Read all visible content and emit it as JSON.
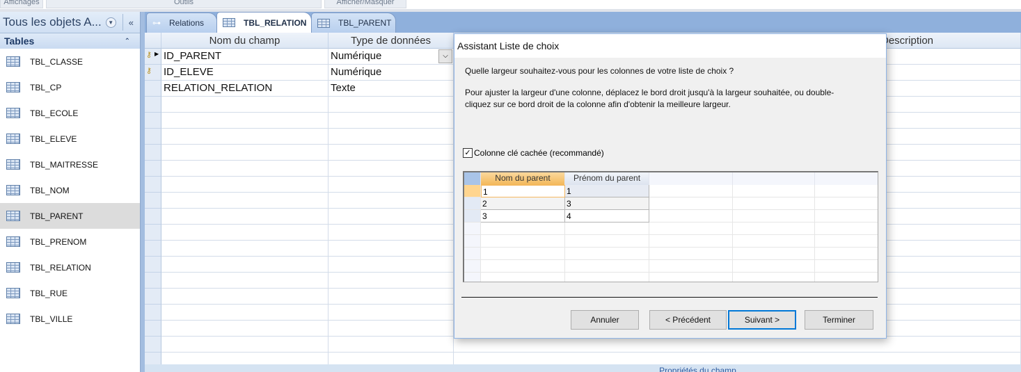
{
  "ribbon": {
    "groups": [
      "Affichages",
      "Outils",
      "Afficher/Masquer"
    ]
  },
  "nav": {
    "title": "Tous les objets A...",
    "section": "Tables",
    "items": [
      "TBL_CLASSE",
      "TBL_CP",
      "TBL_ECOLE",
      "TBL_ELEVE",
      "TBL_MAITRESSE",
      "TBL_NOM",
      "TBL_PARENT",
      "TBL_PRENOM",
      "TBL_RELATION",
      "TBL_RUE",
      "TBL_VILLE"
    ],
    "selected": "TBL_PARENT"
  },
  "tabs": [
    {
      "label": "Relations"
    },
    {
      "label": "TBL_RELATION",
      "active": true
    },
    {
      "label": "TBL_PARENT"
    }
  ],
  "grid": {
    "headers": [
      "Nom du champ",
      "Type de données",
      "Description"
    ],
    "rows": [
      {
        "name": "ID_PARENT",
        "type": "Numérique",
        "key": true,
        "current": true
      },
      {
        "name": "ID_ELEVE",
        "type": "Numérique",
        "key": true
      },
      {
        "name": "RELATION_RELATION",
        "type": "Texte"
      }
    ]
  },
  "bottom": {
    "label": "Propriétés du champ"
  },
  "dialog": {
    "title": "Assistant Liste de choix",
    "question": "Quelle largeur souhaitez-vous pour les colonnes de votre liste de choix ?",
    "instructions_1": "Pour ajuster la largeur d'une colonne, déplacez le bord droit jusqu'à la largeur souhaitée, ou double-",
    "instructions_2": "cliquez sur ce bord droit de la colonne afin d'obtenir la meilleure largeur.",
    "checkbox_label": "Colonne clé cachée (recommandé)",
    "checkbox_checked": true,
    "preview": {
      "headers": [
        "Nom du parent",
        "Prénom du parent"
      ],
      "rows": [
        [
          "1",
          "1"
        ],
        [
          "2",
          "3"
        ],
        [
          "3",
          "4"
        ]
      ]
    },
    "buttons": {
      "cancel": "Annuler",
      "previous": "< Précédent",
      "next": "Suivant >",
      "finish": "Terminer"
    }
  },
  "colors": {
    "accent": "#0078d7",
    "tabstrip": "#8fb0dc",
    "selected_header": "#f6c56a"
  }
}
